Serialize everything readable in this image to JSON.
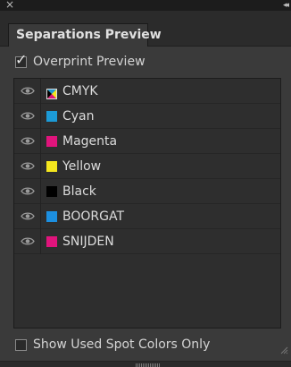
{
  "window": {
    "close_glyph": "×",
    "collapse_glyph": "◂◂"
  },
  "tab": {
    "label": "Separations Preview"
  },
  "overprint": {
    "label": "Overprint Preview",
    "checked": true
  },
  "separations": [
    {
      "name": "CMYK",
      "color": "cmyk",
      "visible": true
    },
    {
      "name": "Cyan",
      "color": "#1c9ad6",
      "visible": true
    },
    {
      "name": "Magenta",
      "color": "#e0147c",
      "visible": true
    },
    {
      "name": "Yellow",
      "color": "#f4e61e",
      "visible": true
    },
    {
      "name": "Black",
      "color": "#000000",
      "visible": true
    },
    {
      "name": "BOORGAT",
      "color": "#1c8fe0",
      "visible": true
    },
    {
      "name": "SNIJDEN",
      "color": "#e0147c",
      "visible": true
    }
  ],
  "spot_only": {
    "label": "Show Used Spot Colors Only",
    "checked": false
  },
  "icons": {
    "visibility": "eye-icon",
    "check": "check-icon",
    "close": "close-icon",
    "collapse": "double-chevron-left-icon",
    "resize": "resize-grip-icon"
  }
}
